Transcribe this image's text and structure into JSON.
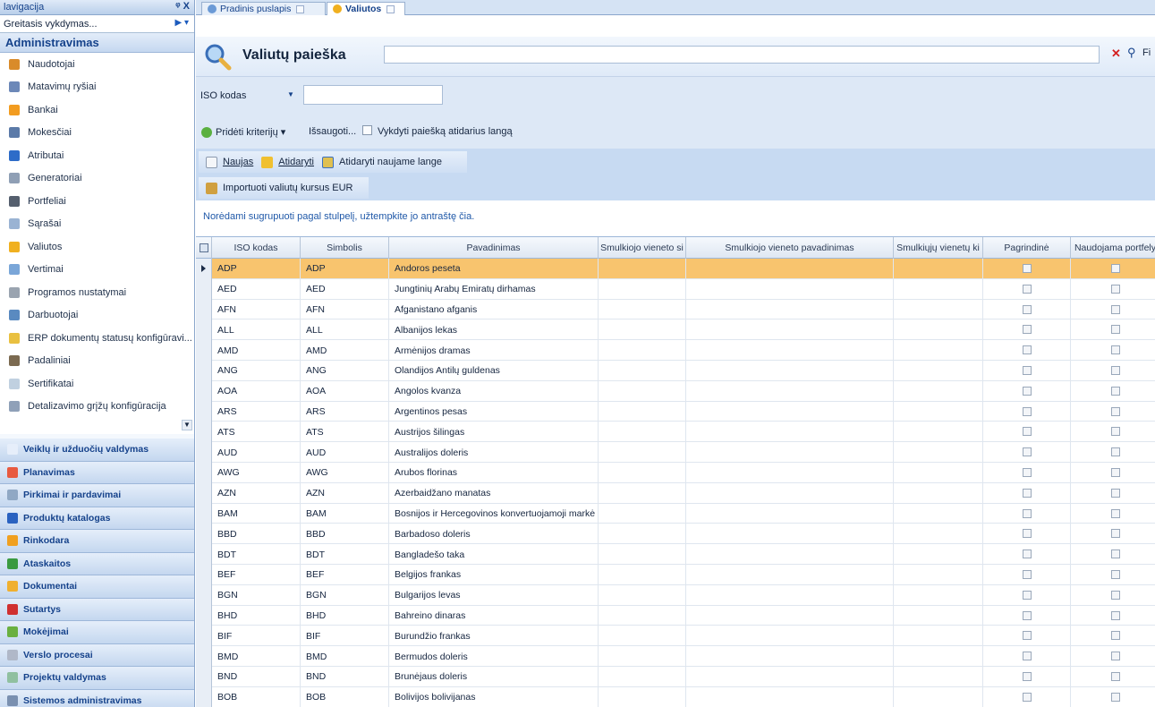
{
  "nav": {
    "title": "lavigacija",
    "pin": "ᵠ X",
    "quick": "Greitasis vykdymas...",
    "group": "Administravimas",
    "items": [
      {
        "label": "Naudotojai",
        "color": "#d98b2a"
      },
      {
        "label": "Matavimų ryšiai",
        "color": "#6c88b8"
      },
      {
        "label": "Bankai",
        "color": "#f29c20"
      },
      {
        "label": "Mokesčiai",
        "color": "#5b7aa8"
      },
      {
        "label": "Atributai",
        "color": "#2e6cc8"
      },
      {
        "label": "Generatoriai",
        "color": "#8f9fb5"
      },
      {
        "label": "Portfeliai",
        "color": "#555f6e"
      },
      {
        "label": "Sąrašai",
        "color": "#9ab3d3"
      },
      {
        "label": "Valiutos",
        "color": "#f0b020"
      },
      {
        "label": "Vertimai",
        "color": "#7aa6d8"
      },
      {
        "label": "Programos nustatymai",
        "color": "#9aa4b0"
      },
      {
        "label": "Darbuotojai",
        "color": "#5a8ac0"
      },
      {
        "label": "ERP dokumentų statusų konfigūravi...",
        "color": "#e9c040"
      },
      {
        "label": "Padaliniai",
        "color": "#7b6a50"
      },
      {
        "label": "Sertifikatai",
        "color": "#c0d0e0"
      },
      {
        "label": "Detalizavimo grįžų konfigūracija",
        "color": "#8fa0b8"
      }
    ],
    "categories": [
      {
        "label": "Veiklų ir užduočių valdymas",
        "color": "#e6eefa"
      },
      {
        "label": "Planavimas",
        "color": "#e85a40"
      },
      {
        "label": "Pirkimai ir pardavimai",
        "color": "#90a8c4"
      },
      {
        "label": "Produktų katalogas",
        "color": "#2a62c0"
      },
      {
        "label": "Rinkodara",
        "color": "#f0a020"
      },
      {
        "label": "Ataskaitos",
        "color": "#3a9a40"
      },
      {
        "label": "Dokumentai",
        "color": "#f0b030"
      },
      {
        "label": "Sutartys",
        "color": "#d03030"
      },
      {
        "label": "Mokėjimai",
        "color": "#6ab040"
      },
      {
        "label": "Verslo procesai",
        "color": "#b0b8c8"
      },
      {
        "label": "Projektų valdymas",
        "color": "#90c0a0"
      },
      {
        "label": "Sistemos administravimas",
        "color": "#7a90b0"
      }
    ]
  },
  "tabs": [
    {
      "label": "Pradinis puslapis",
      "active": false
    },
    {
      "label": "Valiutos",
      "active": true
    }
  ],
  "search": {
    "title": "Valiutų paieška",
    "filter_label": "Fi"
  },
  "criteria": {
    "iso_label": "ISO kodas",
    "add_label": "Pridėti kriterijų ▾",
    "save_label": "Išsaugoti...",
    "exec_label": "Vykdyti paiešką atidarius langą"
  },
  "toolbar": {
    "new_label": "Naujas",
    "open_label": "Atidaryti",
    "open_new_label": "Atidaryti naujame lange",
    "import_label": "Importuoti valiutų kursus EUR"
  },
  "group_hint": "Norėdami sugrupuoti pagal stulpelį, užtempkite jo antraštę čia.",
  "grid": {
    "columns": [
      "ISO kodas",
      "Simbolis",
      "Pavadinimas",
      "Smulkiojo vieneto si",
      "Smulkiojo vieneto pavadinimas",
      "Smulkiųjų vienetų ki",
      "Pagrindinė",
      "Naudojama portfely"
    ],
    "rows": [
      [
        "ADP",
        "ADP",
        "Andoros peseta"
      ],
      [
        "AED",
        "AED",
        "Jungtinių Arabų Emiratų dirhamas"
      ],
      [
        "AFN",
        "AFN",
        "Afganistano afganis"
      ],
      [
        "ALL",
        "ALL",
        "Albanijos lekas"
      ],
      [
        "AMD",
        "AMD",
        "Armėnijos dramas"
      ],
      [
        "ANG",
        "ANG",
        "Olandijos Antilų guldenas"
      ],
      [
        "AOA",
        "AOA",
        "Angolos kvanza"
      ],
      [
        "ARS",
        "ARS",
        "Argentinos pesas"
      ],
      [
        "ATS",
        "ATS",
        "Austrijos šilingas"
      ],
      [
        "AUD",
        "AUD",
        "Australijos doleris"
      ],
      [
        "AWG",
        "AWG",
        "Arubos florinas"
      ],
      [
        "AZN",
        "AZN",
        "Azerbaidžano manatas"
      ],
      [
        "BAM",
        "BAM",
        "Bosnijos ir Hercegovinos konvertuojamoji markė"
      ],
      [
        "BBD",
        "BBD",
        "Barbadoso doleris"
      ],
      [
        "BDT",
        "BDT",
        "Bangladešo taka"
      ],
      [
        "BEF",
        "BEF",
        "Belgijos frankas"
      ],
      [
        "BGN",
        "BGN",
        "Bulgarijos levas"
      ],
      [
        "BHD",
        "BHD",
        "Bahreino dinaras"
      ],
      [
        "BIF",
        "BIF",
        "Burundžio frankas"
      ],
      [
        "BMD",
        "BMD",
        "Bermudos doleris"
      ],
      [
        "BND",
        "BND",
        "Brunėjaus doleris"
      ],
      [
        "BOB",
        "BOB",
        "Bolivijos bolivijanas"
      ]
    ]
  }
}
